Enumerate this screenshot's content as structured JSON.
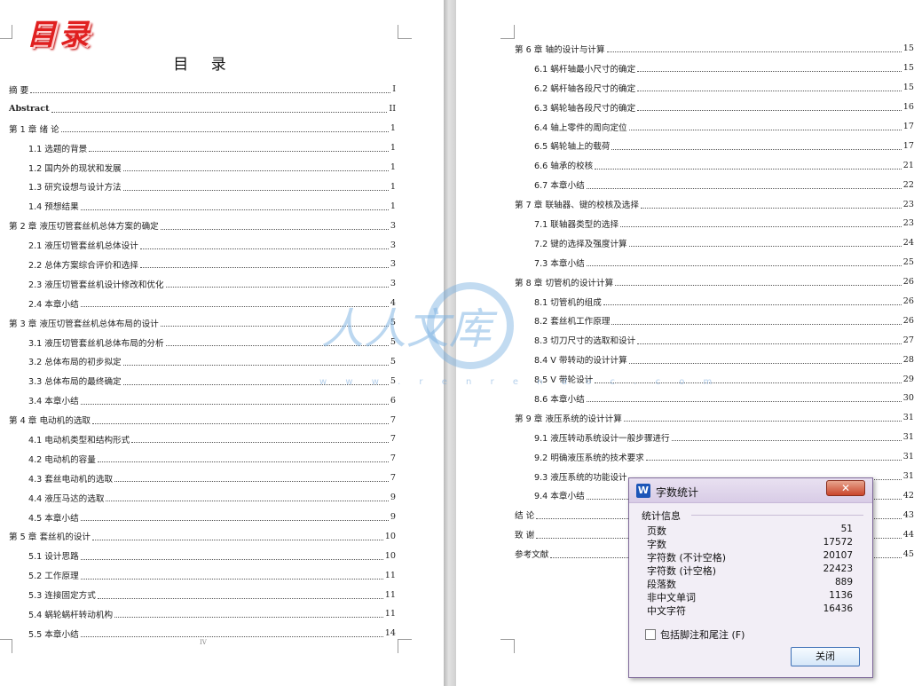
{
  "left_page": {
    "decor_title": "目录",
    "heading": "目 录",
    "footer_page": "IV",
    "toc": [
      {
        "title": "摘   要",
        "page": "I",
        "level": 1,
        "bold": false
      },
      {
        "title": "Abstract",
        "page": "II",
        "level": 1,
        "bold": true
      },
      {
        "title": "第 1 章  绪   论",
        "page": "1",
        "level": 1,
        "bold": false
      },
      {
        "title": "1.1  选题的背景",
        "page": "1",
        "level": 2,
        "bold": false
      },
      {
        "title": "1.2  国内外的现状和发展",
        "page": "1",
        "level": 2,
        "bold": false
      },
      {
        "title": "1.3  研究设想与设计方法",
        "page": "1",
        "level": 2,
        "bold": false
      },
      {
        "title": "1.4  预想结果",
        "page": "1",
        "level": 2,
        "bold": false
      },
      {
        "title": "第 2 章  液压切管套丝机总体方案的确定",
        "page": "3",
        "level": 1,
        "bold": false
      },
      {
        "title": "2.1  液压切管套丝机总体设计",
        "page": "3",
        "level": 2,
        "bold": false
      },
      {
        "title": "2.2 总体方案综合评价和选择",
        "page": "3",
        "level": 2,
        "bold": false
      },
      {
        "title": "2.3 液压切管套丝机设计修改和优化",
        "page": "3",
        "level": 2,
        "bold": false
      },
      {
        "title": "2.4 本章小结",
        "page": "4",
        "level": 2,
        "bold": false
      },
      {
        "title": "第 3 章  液压切管套丝机总体布局的设计",
        "page": "5",
        "level": 1,
        "bold": false
      },
      {
        "title": "3.1  液压切管套丝机总体布局的分析",
        "page": "5",
        "level": 2,
        "bold": false
      },
      {
        "title": "3.2  总体布局的初步拟定",
        "page": "5",
        "level": 2,
        "bold": false
      },
      {
        "title": "3.3  总体布局的最终确定",
        "page": "5",
        "level": 2,
        "bold": false
      },
      {
        "title": "3.4  本章小结",
        "page": "6",
        "level": 2,
        "bold": false
      },
      {
        "title": "第 4 章  电动机的选取",
        "page": "7",
        "level": 1,
        "bold": false
      },
      {
        "title": "4.1 电动机类型和结构形式",
        "page": "7",
        "level": 2,
        "bold": false
      },
      {
        "title": "4.2  电动机的容量",
        "page": "7",
        "level": 2,
        "bold": false
      },
      {
        "title": "4.3 套丝电动机的选取",
        "page": "7",
        "level": 2,
        "bold": false
      },
      {
        "title": "4.4 液压马达的选取",
        "page": "9",
        "level": 2,
        "bold": false
      },
      {
        "title": "4.5 本章小结",
        "page": "9",
        "level": 2,
        "bold": false
      },
      {
        "title": "第 5 章  套丝机的设计",
        "page": "10",
        "level": 1,
        "bold": false
      },
      {
        "title": "5.1 设计思路",
        "page": "10",
        "level": 2,
        "bold": false
      },
      {
        "title": "5.2 工作原理",
        "page": "11",
        "level": 2,
        "bold": false
      },
      {
        "title": "5.3 连接固定方式",
        "page": "11",
        "level": 2,
        "bold": false
      },
      {
        "title": "5.4 蜗轮蜗杆转动机构",
        "page": "11",
        "level": 2,
        "bold": false
      },
      {
        "title": "5.5 本章小结",
        "page": "14",
        "level": 2,
        "bold": false
      }
    ]
  },
  "right_page": {
    "toc": [
      {
        "title": "第 6 章  轴的设计与计算",
        "page": "15",
        "level": 1,
        "bold": false
      },
      {
        "title": "6.1 蜗杆轴最小尺寸的确定",
        "page": "15",
        "level": 2,
        "bold": false
      },
      {
        "title": "6.2 蜗杆轴各段尺寸的确定",
        "page": "15",
        "level": 2,
        "bold": false
      },
      {
        "title": "6.3 蜗轮轴各段尺寸的确定",
        "page": "16",
        "level": 2,
        "bold": false
      },
      {
        "title": "6.4 轴上零件的周向定位",
        "page": "17",
        "level": 2,
        "bold": false
      },
      {
        "title": "6.5 蜗轮轴上的载荷",
        "page": "17",
        "level": 2,
        "bold": false
      },
      {
        "title": "6.6 轴承的校核",
        "page": "21",
        "level": 2,
        "bold": false
      },
      {
        "title": "6.7 本章小结",
        "page": "22",
        "level": 2,
        "bold": false
      },
      {
        "title": "第 7 章   联轴器、键的校核及选择",
        "page": "23",
        "level": 1,
        "bold": false
      },
      {
        "title": "7.1 联轴器类型的选择",
        "page": "23",
        "level": 2,
        "bold": false
      },
      {
        "title": "7.2 键的选择及强度计算",
        "page": "24",
        "level": 2,
        "bold": false
      },
      {
        "title": "7.3 本章小结",
        "page": "25",
        "level": 2,
        "bold": false
      },
      {
        "title": "第 8 章   切管机的设计计算",
        "page": "26",
        "level": 1,
        "bold": false
      },
      {
        "title": "8.1 切管机的组成",
        "page": "26",
        "level": 2,
        "bold": false
      },
      {
        "title": "8.2 套丝机工作原理",
        "page": "26",
        "level": 2,
        "bold": false
      },
      {
        "title": "8.3 切刀尺寸的选取和设计",
        "page": "27",
        "level": 2,
        "bold": false
      },
      {
        "title": "8.4 V 带转动的设计计算",
        "page": "28",
        "level": 2,
        "bold": false
      },
      {
        "title": "8.5 V 带轮设计",
        "page": "29",
        "level": 2,
        "bold": false
      },
      {
        "title": "8.6 本章小结",
        "page": "30",
        "level": 2,
        "bold": false
      },
      {
        "title": "第 9 章  液压系统的设计计算",
        "page": "31",
        "level": 1,
        "bold": false
      },
      {
        "title": "9.1 液压转动系统设计一般步骤进行",
        "page": "31",
        "level": 2,
        "bold": false
      },
      {
        "title": "9.2 明确液压系统的技术要求",
        "page": "31",
        "level": 2,
        "bold": false
      },
      {
        "title": "9.3 液压系统的功能设计",
        "page": "31",
        "level": 2,
        "bold": false
      },
      {
        "title": "9.4 本章小结",
        "page": "42",
        "level": 2,
        "bold": false
      },
      {
        "title": "结   论",
        "page": "43",
        "level": 1,
        "bold": false
      },
      {
        "title": "致   谢",
        "page": "44",
        "level": 1,
        "bold": false
      },
      {
        "title": "参考文献",
        "page": "45",
        "level": 1,
        "bold": false
      }
    ]
  },
  "watermark": {
    "logo_text": "人人文库",
    "url": "w w w . r e n r e n d o c . c o m"
  },
  "dialog": {
    "title": "字数统计",
    "app_icon_letter": "W",
    "close_glyph": "✕",
    "group_label": "统计信息",
    "stats": [
      {
        "label": "页数",
        "value": "51"
      },
      {
        "label": "字数",
        "value": "17572"
      },
      {
        "label": "字符数 (不计空格)",
        "value": "20107"
      },
      {
        "label": "字符数 (计空格)",
        "value": "22423"
      },
      {
        "label": "段落数",
        "value": "889"
      },
      {
        "label": "非中文单词",
        "value": "1136"
      },
      {
        "label": "中文字符",
        "value": "16436"
      }
    ],
    "checkbox_label": "包括脚注和尾注 (F)",
    "checkbox_checked": false,
    "close_button_label": "关闭"
  }
}
